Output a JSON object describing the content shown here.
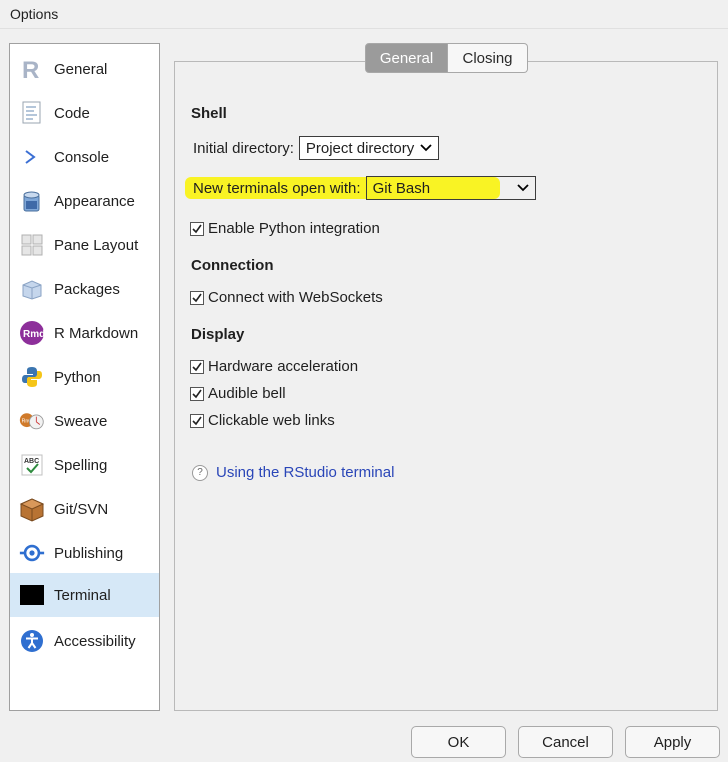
{
  "window": {
    "title": "Options"
  },
  "sidebar": {
    "items": [
      {
        "label": "General",
        "icon": "r-logo-icon"
      },
      {
        "label": "Code",
        "icon": "code-document-icon"
      },
      {
        "label": "Console",
        "icon": "console-prompt-icon"
      },
      {
        "label": "Appearance",
        "icon": "paint-bucket-icon"
      },
      {
        "label": "Pane Layout",
        "icon": "pane-layout-icon"
      },
      {
        "label": "Packages",
        "icon": "package-icon"
      },
      {
        "label": "R Markdown",
        "icon": "rmd-icon"
      },
      {
        "label": "Python",
        "icon": "python-logo-icon"
      },
      {
        "label": "Sweave",
        "icon": "sweave-icon"
      },
      {
        "label": "Spelling",
        "icon": "spelling-abc-icon"
      },
      {
        "label": "Git/SVN",
        "icon": "git-box-icon"
      },
      {
        "label": "Publishing",
        "icon": "publishing-icon"
      },
      {
        "label": "Terminal",
        "icon": "terminal-icon"
      },
      {
        "label": "Accessibility",
        "icon": "accessibility-icon"
      }
    ],
    "selected": "Terminal"
  },
  "tabs": {
    "general": "General",
    "closing": "Closing",
    "active": "General"
  },
  "shell": {
    "heading": "Shell",
    "initial_dir_label": "Initial directory:",
    "initial_dir_value": "Project directory",
    "new_terminals_label": "New terminals open with:",
    "new_terminals_value": "Git Bash",
    "python_integration": "Enable Python integration"
  },
  "connection": {
    "heading": "Connection",
    "websockets": "Connect with WebSockets"
  },
  "display": {
    "heading": "Display",
    "hardware_accel": "Hardware acceleration",
    "audible_bell": "Audible bell",
    "clickable_links": "Clickable web links"
  },
  "help": {
    "link": "Using the RStudio terminal"
  },
  "buttons": {
    "ok": "OK",
    "cancel": "Cancel",
    "apply": "Apply"
  },
  "colors": {
    "highlight": "#f9f324",
    "selected_bg": "#d6e8f7",
    "link": "#2a46b8",
    "active_tab": "#9b9b9b"
  }
}
